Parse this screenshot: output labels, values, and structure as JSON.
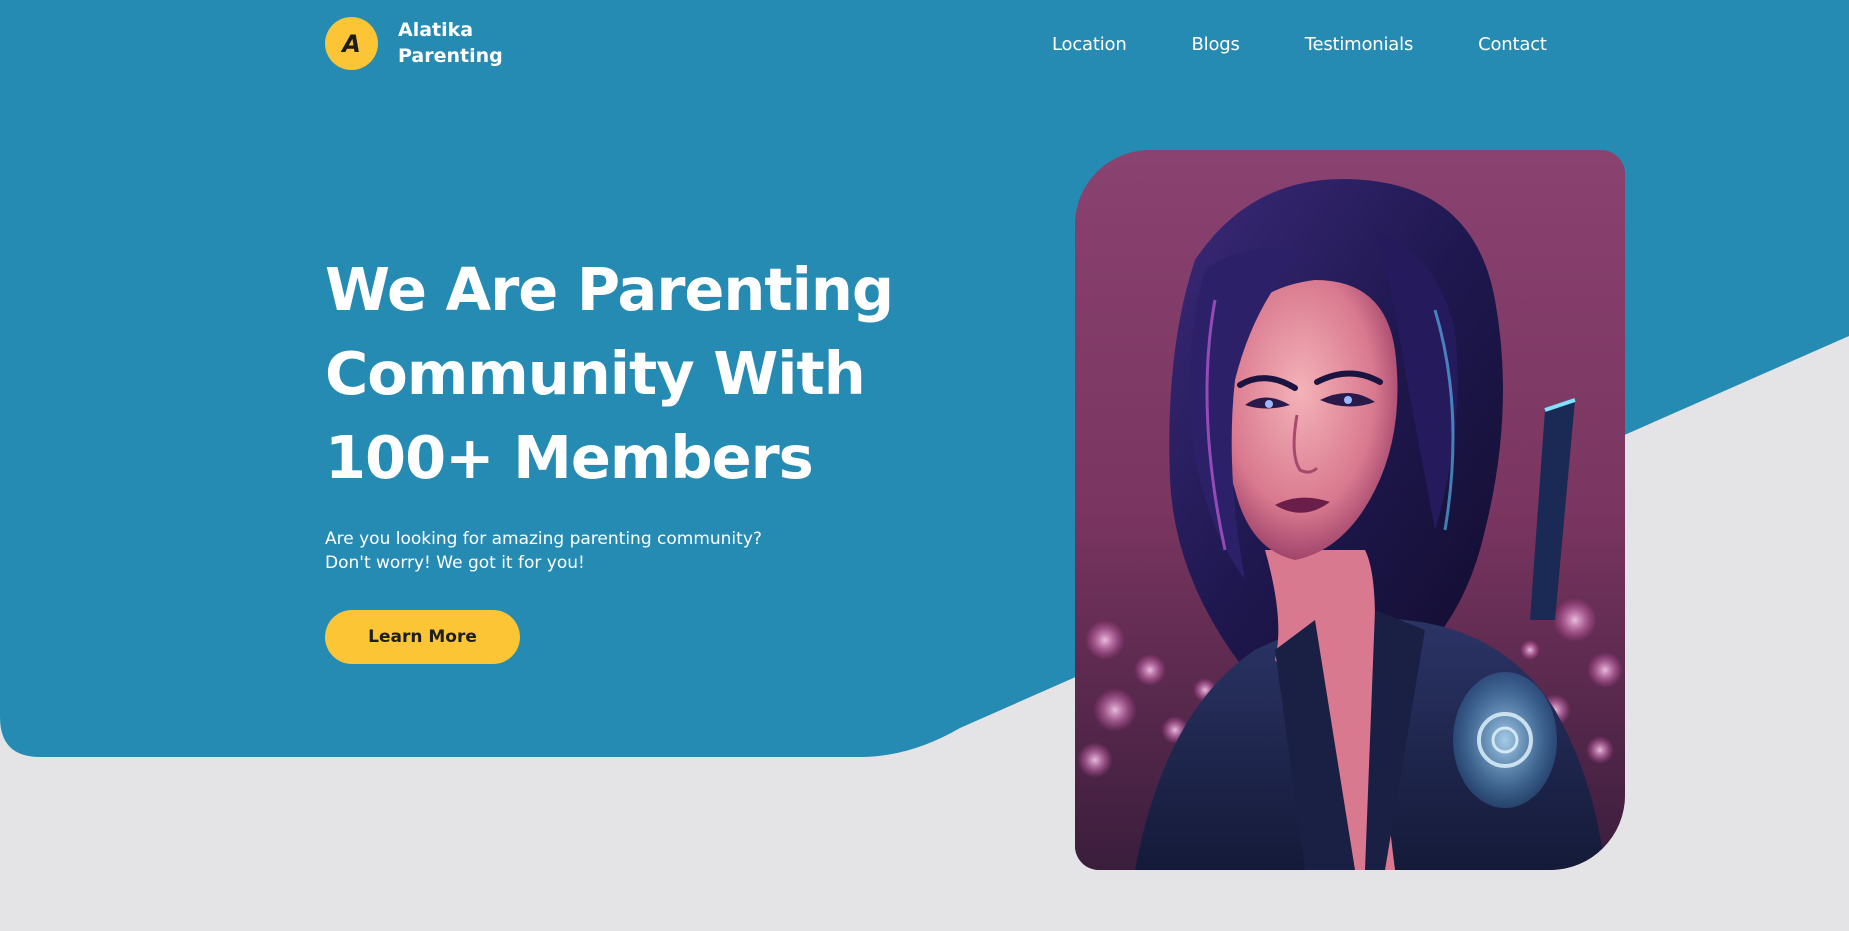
{
  "brand": {
    "logo_letter": "A",
    "name_line1": "Alatika",
    "name_line2": "Parenting"
  },
  "nav": {
    "items": [
      "Location",
      "Blogs",
      "Testimonials",
      "Contact"
    ]
  },
  "hero": {
    "headline_lines": [
      "We Are Parenting",
      "Community With",
      "100+ Members"
    ],
    "subtext_lines": [
      "Are you looking for amazing parenting community?",
      "Don't worry! We got it for you!"
    ],
    "cta_label": "Learn More",
    "image_subject": "illustrated portrait of a woman with dark purple hair and glowing tattoo"
  },
  "colors": {
    "primary_blue": "#268bb3",
    "accent_yellow": "#fcc536",
    "page_bg": "#e4e4e6",
    "text_white": "#ffffff"
  }
}
